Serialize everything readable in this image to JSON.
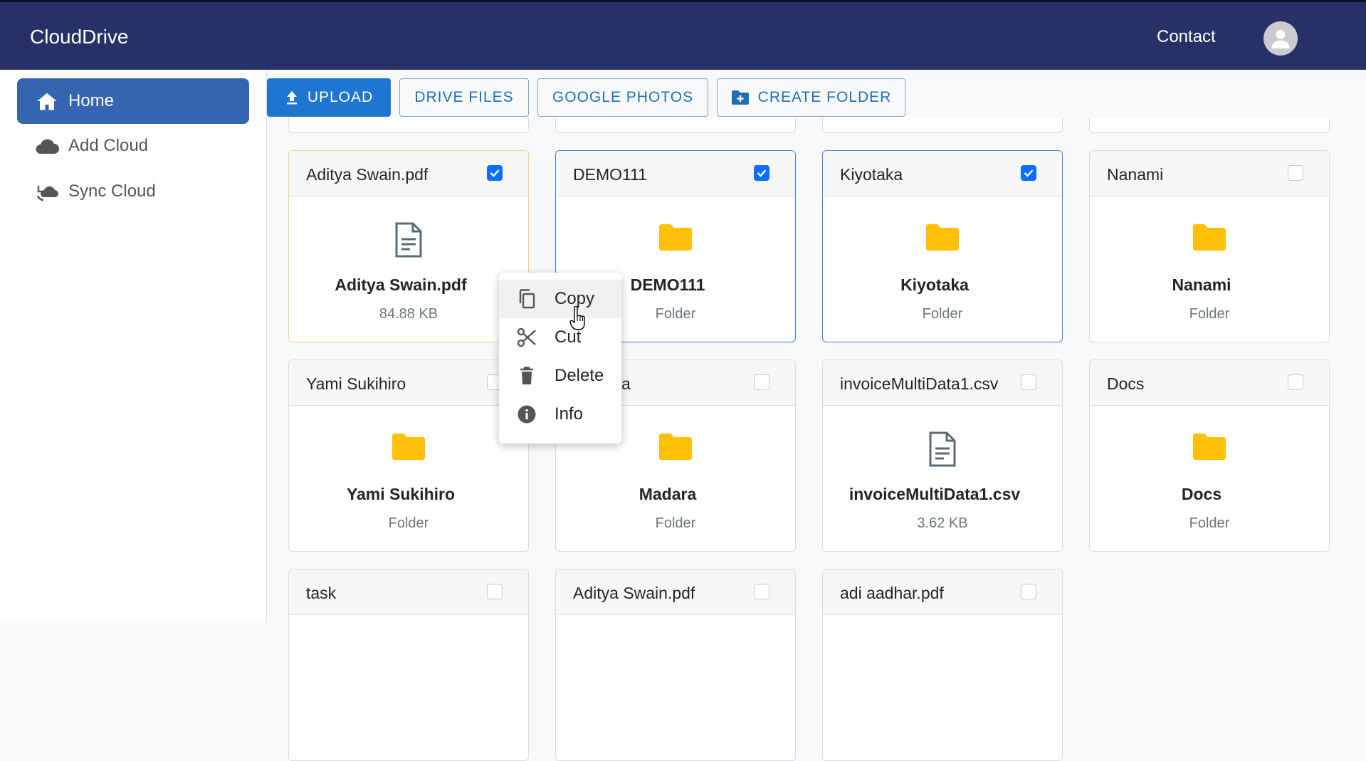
{
  "app": {
    "title": "CloudDrive",
    "contact": "Contact"
  },
  "sidebar": {
    "items": [
      {
        "label": "Home",
        "icon": "home-icon",
        "active": true
      },
      {
        "label": "Add Cloud",
        "icon": "cloud-icon",
        "active": false
      },
      {
        "label": "Sync Cloud",
        "icon": "cloud-sync-icon",
        "active": false
      }
    ]
  },
  "toolbar": {
    "upload": "UPLOAD",
    "drive_files": "DRIVE FILES",
    "google_photos": "GOOGLE PHOTOS",
    "create_folder": "CREATE FOLDER"
  },
  "files": [
    {
      "header": "Aditya Swain.pdf",
      "name": "Aditya Swain.pdf",
      "sub": "84.88 KB",
      "type": "file",
      "checked": true
    },
    {
      "header": "DEMO111",
      "name": "DEMO111",
      "sub": "Folder",
      "type": "folder",
      "checked": true
    },
    {
      "header": "Kiyotaka",
      "name": "Kiyotaka",
      "sub": "Folder",
      "type": "folder",
      "checked": true
    },
    {
      "header": "Nanami",
      "name": "Nanami",
      "sub": "Folder",
      "type": "folder",
      "checked": false
    },
    {
      "header": "Yami Sukihiro",
      "name": "Yami Sukihiro",
      "sub": "Folder",
      "type": "folder",
      "checked": false
    },
    {
      "header": "a",
      "name": "Madara",
      "sub": "Folder",
      "type": "folder",
      "checked": false
    },
    {
      "header": "invoiceMultiData1.csv",
      "name": "invoiceMultiData1.csv",
      "sub": "3.62 KB",
      "type": "file",
      "checked": false
    },
    {
      "header": "Docs",
      "name": "Docs",
      "sub": "Folder",
      "type": "folder",
      "checked": false
    },
    {
      "header": "task",
      "checked": false
    },
    {
      "header": "Aditya Swain.pdf",
      "checked": false
    },
    {
      "header": "adi aadhar.pdf",
      "checked": false
    }
  ],
  "context_menu": {
    "items": [
      {
        "label": "Copy",
        "icon": "copy-icon"
      },
      {
        "label": "Cut",
        "icon": "scissors-icon"
      },
      {
        "label": "Delete",
        "icon": "trash-icon"
      },
      {
        "label": "Info",
        "icon": "info-icon"
      }
    ]
  },
  "colors": {
    "navbar": "#283167",
    "accent": "#1e76d2",
    "folder": "#ffc107",
    "checked": "#0d6efd"
  }
}
